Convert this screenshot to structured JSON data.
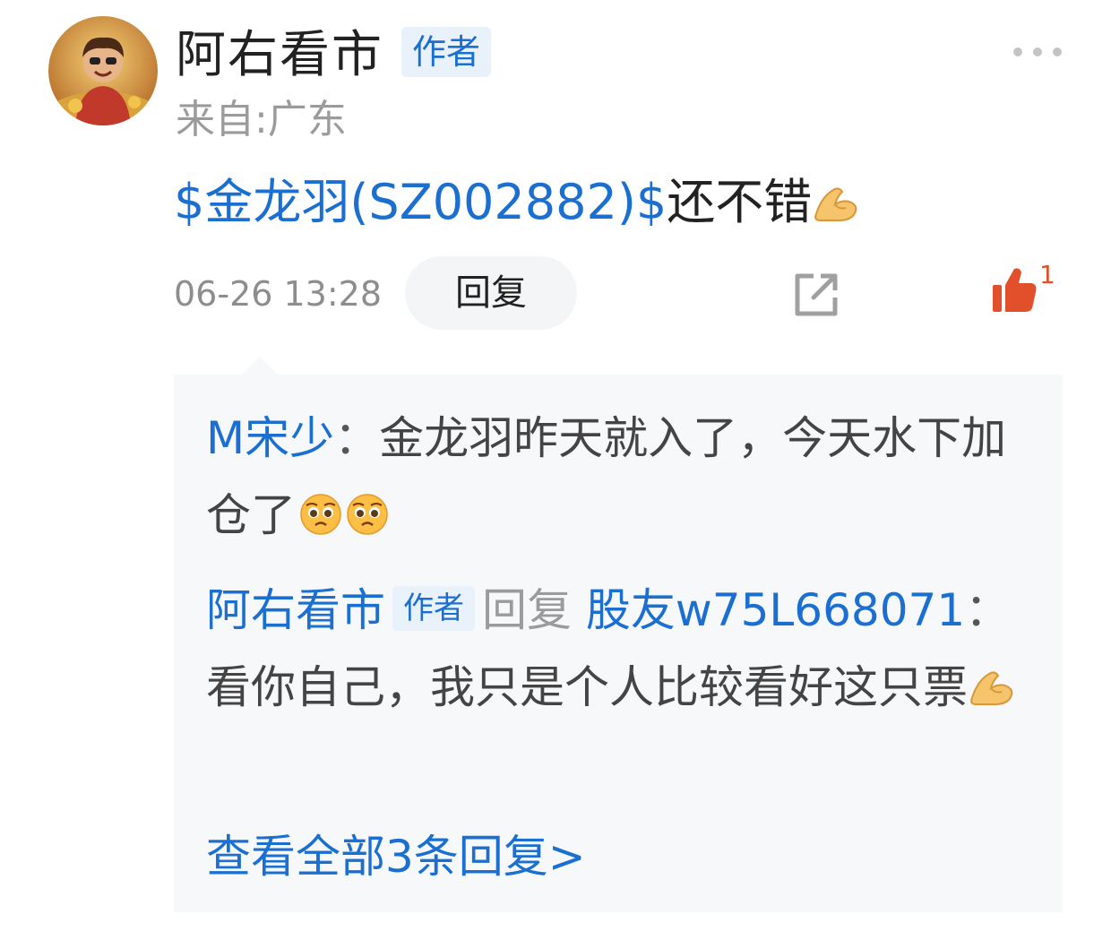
{
  "author": {
    "name": "阿右看市",
    "badge": "作者",
    "location": "来自:广东"
  },
  "post": {
    "stock_link": "$金龙羽(SZ002882)$",
    "text": "还不错",
    "time": "06-26 13:28",
    "reply_label": "回复",
    "like_count": "1"
  },
  "replies": [
    {
      "user": "M宋少",
      "separator": "：",
      "text": "金龙羽昨天就入了，今天水下加仓了"
    },
    {
      "user": "阿右看市",
      "badge": "作者",
      "reply_word": "回复",
      "target": "股友w75L668071",
      "separator": "：",
      "text": "看你自己，我只是个人比较看好这只票"
    }
  ],
  "view_all": "查看全部3条回复>",
  "icons": [
    "avatar",
    "more-icon",
    "ok-hand-emoji",
    "share-icon",
    "like-icon",
    "pleading-face-emoji"
  ],
  "colors": {
    "link": "#1a6fd1",
    "like": "#e2502b",
    "muted": "#9b9b9b"
  }
}
